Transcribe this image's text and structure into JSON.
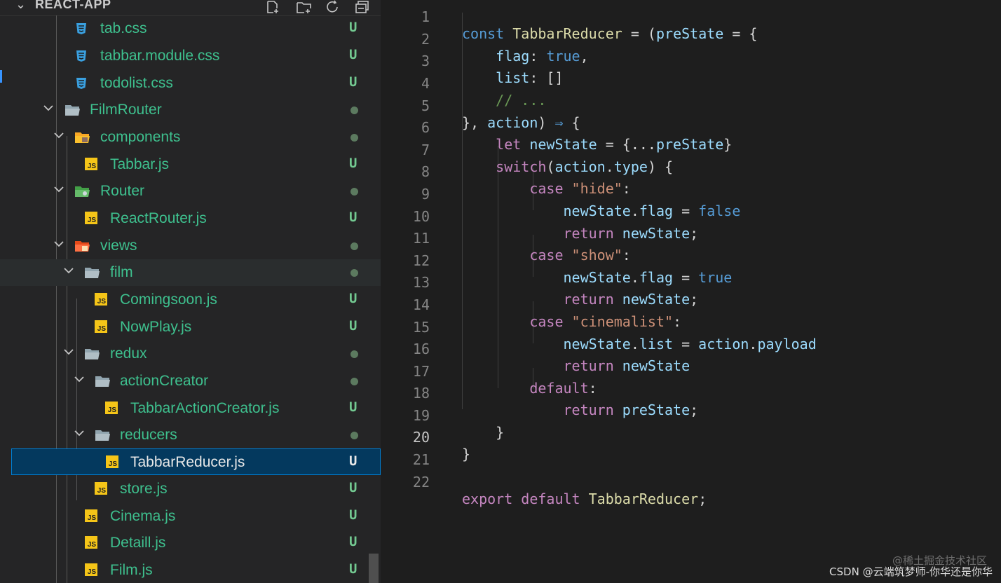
{
  "sidebar": {
    "title": "REACT-APP",
    "items": [
      {
        "label": "tab.css",
        "icon": "css-icon",
        "status": "U"
      },
      {
        "label": "tabbar.module.css",
        "icon": "css-icon",
        "status": "U"
      },
      {
        "label": "todolist.css",
        "icon": "css-icon",
        "status": "U"
      },
      {
        "label": "FilmRouter",
        "icon": "folder-open-icon",
        "status": "●"
      },
      {
        "label": "components",
        "icon": "components-folder-icon",
        "status": "●"
      },
      {
        "label": "Tabbar.js",
        "icon": "js-icon",
        "status": "U"
      },
      {
        "label": "Router",
        "icon": "router-folder-icon",
        "status": "●"
      },
      {
        "label": "ReactRouter.js",
        "icon": "js-icon",
        "status": "U"
      },
      {
        "label": "views",
        "icon": "views-folder-icon",
        "status": "●"
      },
      {
        "label": "film",
        "icon": "folder-open-icon",
        "status": "●"
      },
      {
        "label": "Comingsoon.js",
        "icon": "js-icon",
        "status": "U"
      },
      {
        "label": "NowPlay.js",
        "icon": "js-icon",
        "status": "U"
      },
      {
        "label": "redux",
        "icon": "folder-open-icon",
        "status": "●"
      },
      {
        "label": "actionCreator",
        "icon": "folder-open-icon",
        "status": "●"
      },
      {
        "label": "TabbarActionCreator.js",
        "icon": "js-icon",
        "status": "U"
      },
      {
        "label": "reducers",
        "icon": "folder-open-icon",
        "status": "●"
      },
      {
        "label": "TabbarReducer.js",
        "icon": "js-icon",
        "status": "U"
      },
      {
        "label": "store.js",
        "icon": "js-icon",
        "status": "U"
      },
      {
        "label": "Cinema.js",
        "icon": "js-icon",
        "status": "U"
      },
      {
        "label": "Detaill.js",
        "icon": "js-icon",
        "status": "U"
      },
      {
        "label": "Film.js",
        "icon": "js-icon",
        "status": "U"
      }
    ]
  },
  "editor": {
    "active_line": "20",
    "lines": [
      {
        "num": "1",
        "text": "const TabbarReducer = (preState = {"
      },
      {
        "num": "2",
        "text": "    flag: true,"
      },
      {
        "num": "3",
        "text": "    list: []"
      },
      {
        "num": "4",
        "text": "    // ..."
      },
      {
        "num": "5",
        "text": "}, action) ⇒ {"
      },
      {
        "num": "6",
        "text": "    let newState = {...preState}"
      },
      {
        "num": "7",
        "text": "    switch(action.type) {"
      },
      {
        "num": "8",
        "text": "        case \"hide\":"
      },
      {
        "num": "9",
        "text": "            newState.flag = false"
      },
      {
        "num": "10",
        "text": "            return newState;"
      },
      {
        "num": "11",
        "text": "        case \"show\":"
      },
      {
        "num": "12",
        "text": "            newState.flag = true"
      },
      {
        "num": "13",
        "text": "            return newState;"
      },
      {
        "num": "14",
        "text": "        case \"cinemalist\":"
      },
      {
        "num": "15",
        "text": "            newState.list = action.payload"
      },
      {
        "num": "16",
        "text": "            return newState"
      },
      {
        "num": "17",
        "text": "        default:"
      },
      {
        "num": "18",
        "text": "            return preState;"
      },
      {
        "num": "19",
        "text": "    }"
      },
      {
        "num": "20",
        "text": "}"
      },
      {
        "num": "21",
        "text": ""
      },
      {
        "num": "22",
        "text": "export default TabbarReducer;"
      }
    ]
  },
  "watermark": {
    "line1": "@稀土掘金技术社区",
    "line2": "CSDN @云端筑梦师-你华还是你华"
  }
}
